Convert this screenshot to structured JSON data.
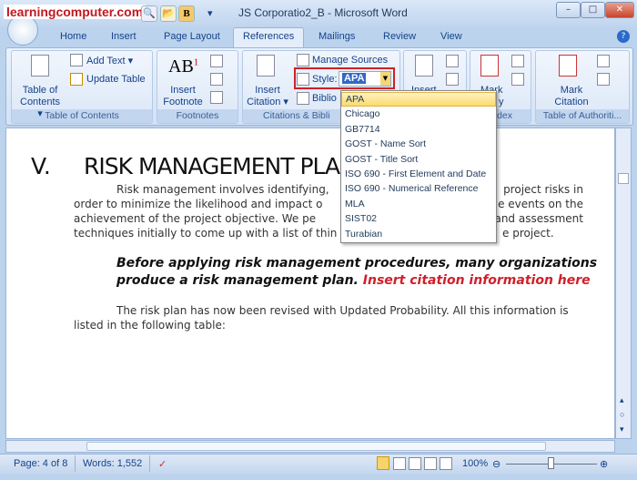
{
  "watermark": "learningcomputer.com",
  "window": {
    "title": "JS Corporatio2_B - Microsoft Word",
    "qat_bold": "B",
    "qat_more": "▾",
    "min": "–",
    "max": "□",
    "close": "✕"
  },
  "tabs": [
    "Home",
    "Insert",
    "Page Layout",
    "References",
    "Mailings",
    "Review",
    "View"
  ],
  "active_tab": "References",
  "help": "?",
  "ribbon": {
    "toc": {
      "button": "Table of Contents ▾",
      "add_text": "Add Text ▾",
      "update_table": "Update Table",
      "label": "Table of Contents"
    },
    "footnotes": {
      "insert_footnote": "Insert Footnote",
      "label": "Footnotes",
      "ab": "AB",
      "sup": "1"
    },
    "citations": {
      "insert_citation": "Insert Citation ▾",
      "manage_sources": "Manage Sources",
      "style_label": "Style:",
      "style_value": "APA",
      "bibliography": "Biblio",
      "label": "Citations & Bibli"
    },
    "captions": {
      "insert": "Insert"
    },
    "index": {
      "mark_entry": "Mark",
      "mark_entry2": "y",
      "label": "dex"
    },
    "authorities": {
      "mark_citation": "Mark Citation",
      "label": "Table of Authoriti..."
    }
  },
  "style_dropdown": {
    "options": [
      "APA",
      "Chicago",
      "GB7714",
      "GOST - Name Sort",
      "GOST - Title Sort",
      "ISO 690 - First Element and Date",
      "ISO 690 - Numerical Reference",
      "MLA",
      "SIST02",
      "Turabian"
    ],
    "selected": "APA"
  },
  "document": {
    "heading_num": "V.",
    "heading": "RISK MANAGEMENT PLA",
    "para1_left": [
      "Risk management involves identifying,",
      "order to minimize the likelihood and impact o",
      "achievement of the project objective. We pe",
      "techniques initially to come up with a list of thin"
    ],
    "para1_right": [
      "project risks in",
      "e events on the",
      "and assessment",
      "e project."
    ],
    "quote_line1": "Before applying risk management procedures, many organizations",
    "quote_line2": "produce a risk management plan.",
    "citation_placeholder": "Insert citation information here",
    "citation_color": "#d0202a",
    "para2_line1": "The risk plan has now been revised with Updated Probability. All this information is",
    "para2_line2": "listed in the following table:"
  },
  "status": {
    "page": "Page: 4 of 8",
    "words": "Words: 1,552",
    "zoom": "100%",
    "zoom_level_percent": 100
  }
}
